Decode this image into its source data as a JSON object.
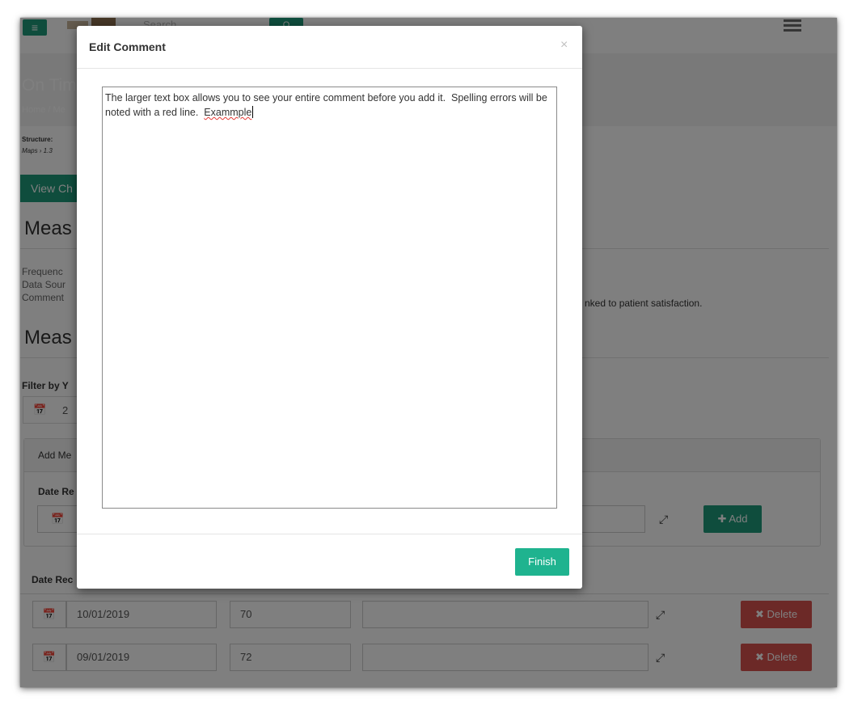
{
  "topbar": {
    "search_placeholder": "Search",
    "search_button_label": "Q"
  },
  "page": {
    "title": "On Time",
    "breadcrumb": "Home  /  Me",
    "structure_label": "Structure:",
    "structure_path": "Maps  ›  1.3",
    "view_button_label": "View Ch",
    "measure_heading_1": "Meas",
    "measure_info_lines": [
      "Frequenc",
      "Data Sour",
      "Comment"
    ],
    "comment_visible_text": "nked to patient satisfaction.",
    "measure_heading_2": "Meas",
    "filter_label": "Filter by Y",
    "filter_value": "2"
  },
  "add_panel": {
    "title": "Add Me",
    "date_label": "Date Re",
    "add_button_label": "Add"
  },
  "table": {
    "date_column_header": "Date Rec",
    "rows": [
      {
        "date": "10/01/2019",
        "value": "70",
        "delete_label": "Delete"
      },
      {
        "date": "09/01/2019",
        "value": "72",
        "delete_label": "Delete"
      }
    ]
  },
  "modal": {
    "title": "Edit Comment",
    "close_glyph": "×",
    "comment_text_main": "The larger text box allows you to see your entire comment before you add it.  Spelling errors will be noted with a red line.  ",
    "comment_text_misspelled": "Exammple",
    "finish_label": "Finish"
  },
  "icons": {
    "menu": "≡",
    "calendar": "📅",
    "expand": "⤢",
    "plus": "✚",
    "delete_x": "✖"
  },
  "colors": {
    "brand_green": "#1f9a7a",
    "finish_green": "#1fb38f",
    "delete_red": "#d9534f",
    "spell_error": "#e53935"
  }
}
